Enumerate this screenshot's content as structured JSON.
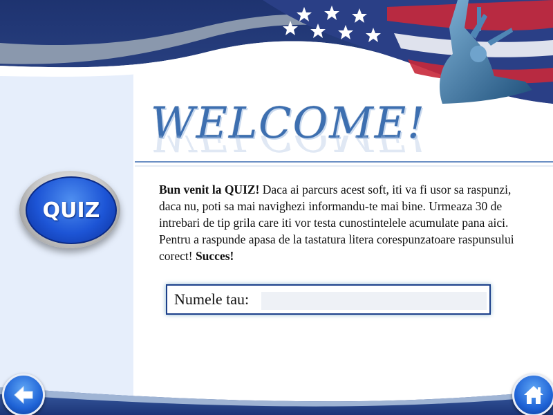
{
  "header": {
    "title": "WELCOME!"
  },
  "quiz_button": {
    "label": "QUIZ"
  },
  "intro": {
    "bold_start": "Bun venit la QUIZ!",
    "body": " Daca ai parcurs acest soft, iti va fi usor sa raspunzi, daca nu, poti sa mai navighezi informandu-te mai bine. Urmeaza 30 de intrebari de tip grila care iti vor testa cunostintelele acumulate pana aici. Pentru a raspunde apasa de la tastatura litera corespunzatoare raspunsului corect! ",
    "bold_end": "Succes!"
  },
  "name_field": {
    "label": "Numele tau:",
    "value": ""
  },
  "nav": {
    "back_icon": "arrow-left-icon",
    "home_icon": "home-icon"
  },
  "colors": {
    "primary_blue": "#233b7a",
    "accent_blue": "#3d6fb0",
    "button_blue": "#1d55d6"
  }
}
